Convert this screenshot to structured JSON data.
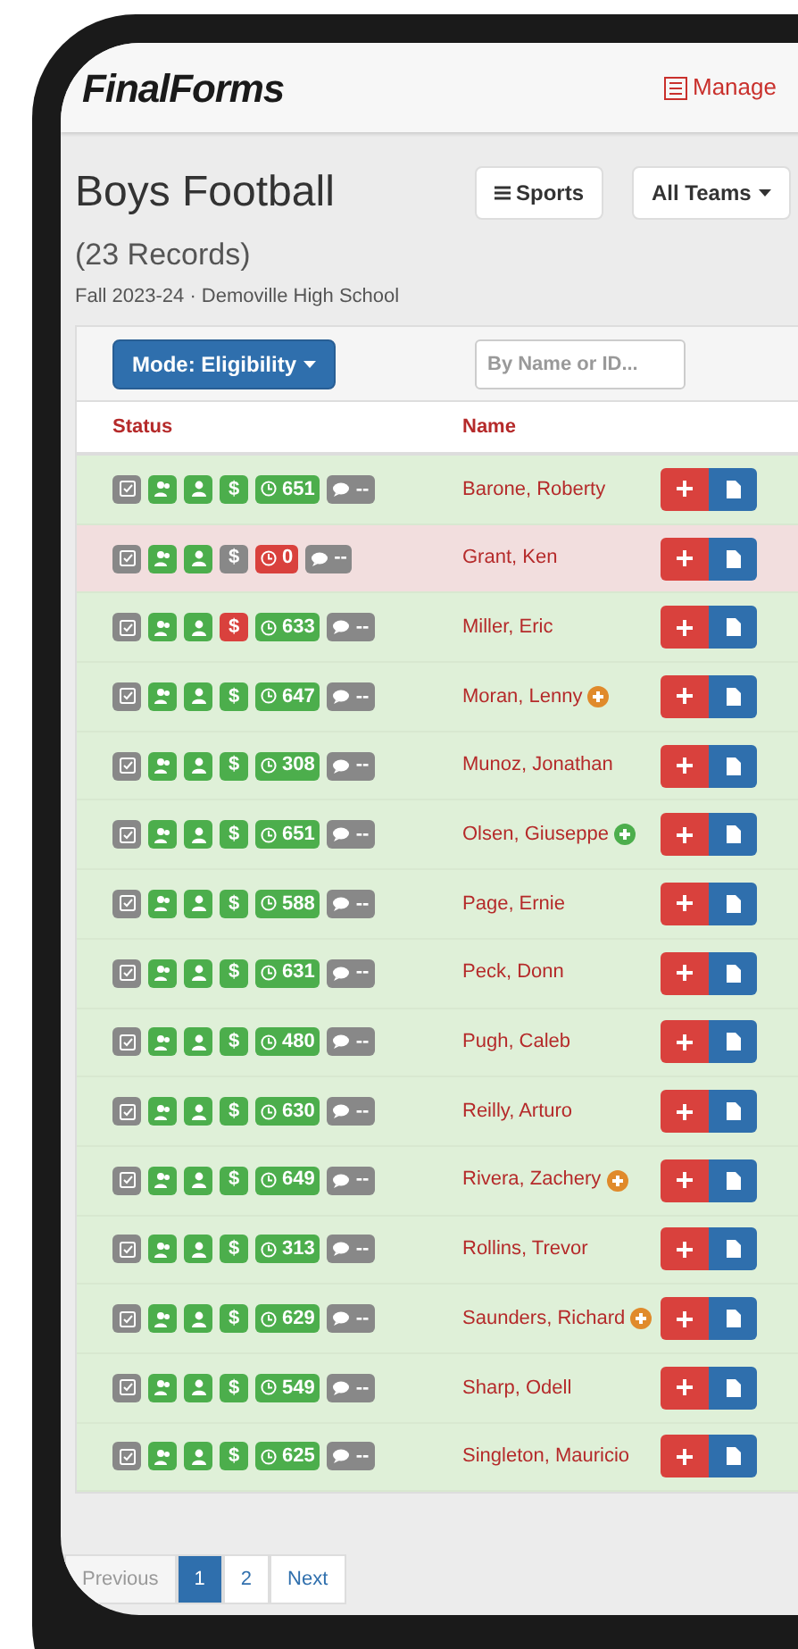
{
  "header": {
    "logo": "FinalForms",
    "manage": "Manage"
  },
  "page": {
    "title": "Boys Football",
    "records": "(23 Records)",
    "subtitle": "Fall 2023-24 · Demoville High School",
    "sports_button": "Sports",
    "teams_button": "All Teams"
  },
  "toolbar": {
    "mode_button": "Mode: Eligibility",
    "search": {
      "placeholder": "By Name or ID..."
    }
  },
  "table": {
    "columns": [
      "Status",
      "Name"
    ],
    "rows": [
      {
        "name": "Barone, Roberty",
        "eligible": true,
        "money": {
          "label": "$",
          "color": "#4cae4c"
        },
        "hours": {
          "label": "651",
          "color": "#4cae4c"
        },
        "comments": "--"
      },
      {
        "name": "Grant, Ken",
        "eligible": false,
        "money": {
          "label": "$",
          "color": "#888888"
        },
        "hours": {
          "label": "0",
          "color": "#d9413d"
        },
        "comments": "--"
      },
      {
        "name": "Miller, Eric",
        "eligible": true,
        "money": {
          "label": "$",
          "color": "#d9413d"
        },
        "hours": {
          "label": "633",
          "color": "#4cae4c"
        },
        "comments": "--"
      },
      {
        "name": "Moran, Lenny",
        "eligible": true,
        "money": {
          "label": "$",
          "color": "#4cae4c"
        },
        "hours": {
          "label": "647",
          "color": "#4cae4c"
        },
        "comments": "--",
        "marker": {
          "color": "#e08a2b"
        }
      },
      {
        "name": "Munoz, Jonathan",
        "eligible": true,
        "money": {
          "label": "$",
          "color": "#4cae4c"
        },
        "hours": {
          "label": "308",
          "color": "#4cae4c"
        },
        "comments": "--"
      },
      {
        "name": "Olsen, Giuseppe",
        "eligible": true,
        "money": {
          "label": "$",
          "color": "#4cae4c"
        },
        "hours": {
          "label": "651",
          "color": "#4cae4c"
        },
        "comments": "--",
        "marker": {
          "color": "#4cae4c"
        }
      },
      {
        "name": "Page, Ernie",
        "eligible": true,
        "money": {
          "label": "$",
          "color": "#4cae4c"
        },
        "hours": {
          "label": "588",
          "color": "#4cae4c"
        },
        "comments": "--"
      },
      {
        "name": "Peck, Donn",
        "eligible": true,
        "money": {
          "label": "$",
          "color": "#4cae4c"
        },
        "hours": {
          "label": "631",
          "color": "#4cae4c"
        },
        "comments": "--"
      },
      {
        "name": "Pugh, Caleb",
        "eligible": true,
        "money": {
          "label": "$",
          "color": "#4cae4c"
        },
        "hours": {
          "label": "480",
          "color": "#4cae4c"
        },
        "comments": "--"
      },
      {
        "name": "Reilly, Arturo",
        "eligible": true,
        "money": {
          "label": "$",
          "color": "#4cae4c"
        },
        "hours": {
          "label": "630",
          "color": "#4cae4c"
        },
        "comments": "--"
      },
      {
        "name": "Rivera, Zachery",
        "eligible": true,
        "money": {
          "label": "$",
          "color": "#4cae4c"
        },
        "hours": {
          "label": "649",
          "color": "#4cae4c"
        },
        "comments": "--",
        "marker": {
          "color": "#e08a2b"
        }
      },
      {
        "name": "Rollins, Trevor",
        "eligible": true,
        "money": {
          "label": "$",
          "color": "#4cae4c"
        },
        "hours": {
          "label": "313",
          "color": "#4cae4c"
        },
        "comments": "--"
      },
      {
        "name": "Saunders, Richard",
        "eligible": true,
        "money": {
          "label": "$",
          "color": "#4cae4c"
        },
        "hours": {
          "label": "629",
          "color": "#4cae4c"
        },
        "comments": "--",
        "marker": {
          "color": "#e08a2b"
        }
      },
      {
        "name": "Sharp, Odell",
        "eligible": true,
        "money": {
          "label": "$",
          "color": "#4cae4c"
        },
        "hours": {
          "label": "549",
          "color": "#4cae4c"
        },
        "comments": "--"
      },
      {
        "name": "Singleton, Mauricio",
        "eligible": true,
        "money": {
          "label": "$",
          "color": "#4cae4c"
        },
        "hours": {
          "label": "625",
          "color": "#4cae4c"
        },
        "comments": "--"
      }
    ]
  },
  "pagination": [
    {
      "label": "Previous",
      "selected": false
    },
    {
      "label": "1",
      "selected": true
    },
    {
      "label": "2",
      "selected": false
    },
    {
      "label": "Next",
      "selected": false
    }
  ]
}
